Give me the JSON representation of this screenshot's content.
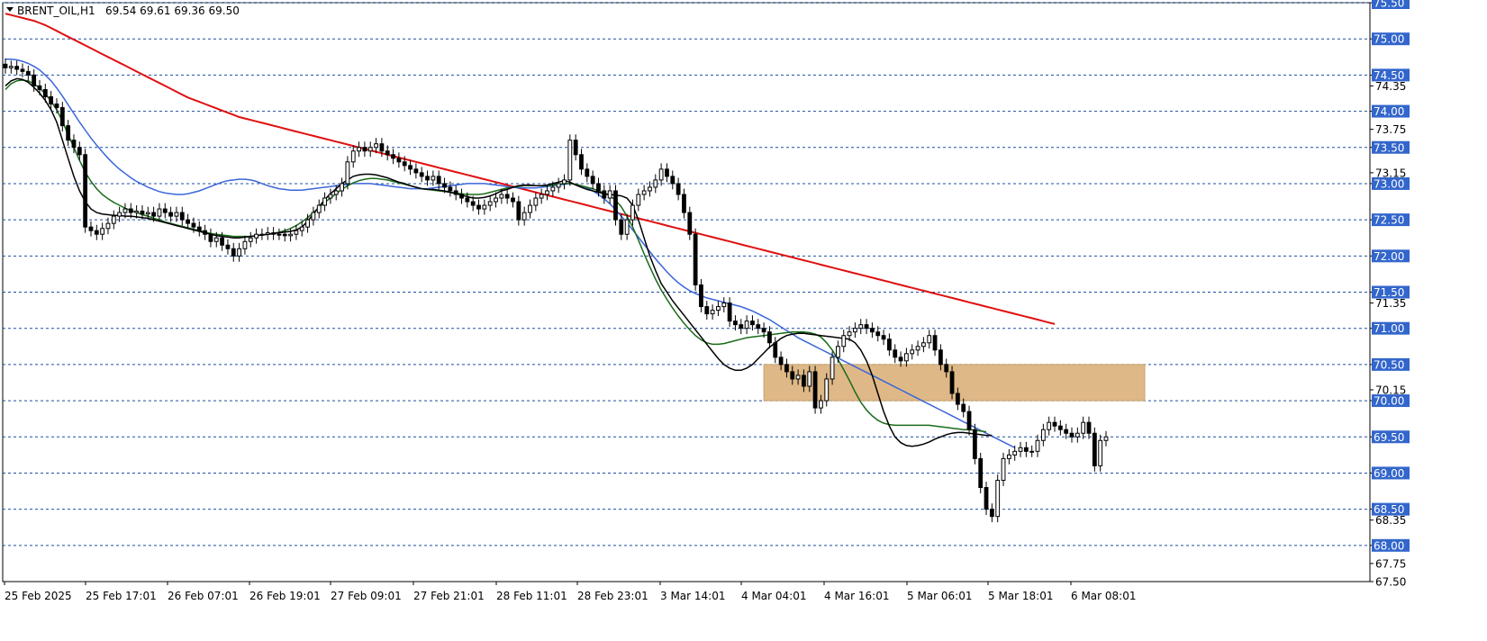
{
  "header": {
    "symbol_label": "BRENT_OIL,H1",
    "ohlc": "69.54 69.61 69.36 69.50"
  },
  "colors": {
    "bullish_candle": "#ffffff",
    "bearish_candle": "#000000",
    "ma_fast": "#000000",
    "ma_mid": "#1a6b1a",
    "ma_slow": "#3a66d9",
    "ma_long": "#e01010",
    "zone_fill": "#deb887",
    "level_line": "#1f4fa0",
    "level_tag_bg": "#3366cc"
  },
  "chart_data": {
    "type": "candlestick",
    "title": "BRENT_OIL,H1",
    "ylim": [
      67.5,
      75.5
    ],
    "y_ticks": [
      "75.50",
      "75.00",
      "74.50",
      "74.35",
      "74.00",
      "73.75",
      "73.50",
      "73.15",
      "73.00",
      "72.50",
      "72.00",
      "71.50",
      "71.35",
      "71.00",
      "70.50",
      "70.15",
      "70.00",
      "69.50",
      "69.00",
      "68.50",
      "68.35",
      "68.00",
      "67.75",
      "67.50"
    ],
    "level_lines": [
      75.5,
      75.0,
      74.5,
      74.0,
      73.5,
      73.0,
      72.5,
      72.0,
      71.5,
      71.0,
      70.5,
      70.0,
      69.5,
      69.0,
      68.5,
      68.0
    ],
    "level_tags": [
      "75.50",
      "75.00",
      "74.50",
      "74.00",
      "73.50",
      "73.00",
      "72.50",
      "72.00",
      "71.50",
      "71.00",
      "70.50",
      "70.00",
      "69.50",
      "69.00",
      "68.50",
      "68.00"
    ],
    "x_labels": [
      "25 Feb 2025",
      "25 Feb 17:01",
      "26 Feb 07:01",
      "26 Feb 19:01",
      "27 Feb 09:01",
      "27 Feb 21:01",
      "28 Feb 11:01",
      "28 Feb 23:01",
      "3 Mar 14:01",
      "4 Mar 04:01",
      "4 Mar 16:01",
      "5 Mar 06:01",
      "5 Mar 18:01",
      "6 Mar 08:01"
    ],
    "zone": {
      "top": 70.5,
      "bottom": 70.0,
      "start_bar": 133,
      "end_bar": 189
    },
    "closes": [
      74.6,
      74.62,
      74.58,
      74.55,
      74.5,
      74.35,
      74.3,
      74.2,
      74.1,
      74.05,
      73.8,
      73.6,
      73.5,
      73.4,
      72.4,
      72.35,
      72.3,
      72.38,
      72.45,
      72.55,
      72.6,
      72.65,
      72.6,
      72.62,
      72.58,
      72.6,
      72.55,
      72.65,
      72.6,
      72.55,
      72.6,
      72.5,
      72.45,
      72.4,
      72.35,
      72.3,
      72.2,
      72.25,
      72.15,
      72.1,
      72.0,
      72.1,
      72.2,
      72.25,
      72.3,
      72.3,
      72.32,
      72.3,
      72.3,
      72.28,
      72.3,
      72.35,
      72.4,
      72.5,
      72.6,
      72.7,
      72.8,
      72.85,
      72.9,
      73.0,
      73.3,
      73.45,
      73.5,
      73.45,
      73.5,
      73.55,
      73.45,
      73.4,
      73.35,
      73.3,
      73.25,
      73.2,
      73.15,
      73.1,
      73.05,
      73.1,
      73.0,
      72.95,
      72.9,
      72.85,
      72.8,
      72.75,
      72.7,
      72.65,
      72.7,
      72.75,
      72.8,
      72.85,
      72.8,
      72.75,
      72.5,
      72.6,
      72.7,
      72.8,
      72.85,
      72.9,
      72.95,
      73.0,
      73.05,
      73.6,
      73.4,
      73.2,
      73.1,
      73.0,
      72.9,
      72.8,
      72.9,
      72.5,
      72.3,
      72.5,
      72.7,
      72.85,
      72.9,
      72.95,
      73.05,
      73.2,
      73.1,
      73.0,
      72.85,
      72.6,
      72.3,
      71.6,
      71.3,
      71.2,
      71.25,
      71.3,
      71.35,
      71.1,
      71.05,
      71.0,
      71.1,
      71.05,
      71.0,
      70.95,
      70.8,
      70.6,
      70.5,
      70.4,
      70.3,
      70.35,
      70.2,
      70.4,
      69.9,
      70.0,
      70.3,
      70.6,
      70.75,
      70.9,
      70.95,
      71.0,
      71.05,
      71.0,
      70.95,
      70.9,
      70.85,
      70.7,
      70.6,
      70.55,
      70.65,
      70.7,
      70.75,
      70.8,
      70.9,
      70.7,
      70.5,
      70.4,
      70.1,
      69.95,
      69.85,
      69.6,
      69.2,
      68.8,
      68.5,
      68.4,
      68.9,
      69.2,
      69.25,
      69.3,
      69.35,
      69.3,
      69.3,
      69.45,
      69.6,
      69.7,
      69.65,
      69.6,
      69.55,
      69.5,
      69.55,
      69.7,
      69.55,
      69.1,
      69.45,
      69.5
    ],
    "ma_fast": [
      74.35,
      74.42,
      74.45,
      74.44,
      74.4,
      74.33,
      74.25,
      74.15,
      74.02,
      73.85,
      73.6,
      73.35,
      73.1,
      72.9,
      72.75,
      72.65,
      72.6,
      72.58,
      72.57,
      72.56,
      72.56,
      72.55,
      72.55,
      72.54,
      72.53,
      72.52,
      72.5,
      72.48,
      72.46,
      72.44,
      72.42,
      72.4,
      72.38,
      72.36,
      72.34,
      72.32,
      72.3,
      72.28,
      72.27,
      72.26,
      72.25,
      72.25,
      72.26,
      72.27,
      72.28,
      72.29,
      72.3,
      72.31,
      72.32,
      72.33,
      72.34,
      72.36,
      72.4,
      72.48,
      72.58,
      72.68,
      72.78,
      72.86,
      72.93,
      73.0,
      73.05,
      73.1,
      73.12,
      73.13,
      73.13,
      73.12,
      73.1,
      73.08,
      73.05,
      73.02,
      73.0,
      72.97,
      72.95,
      72.93,
      72.92,
      72.92,
      72.91,
      72.9,
      72.88,
      72.86,
      72.84,
      72.82,
      72.8,
      72.8,
      72.81,
      72.83,
      72.86,
      72.9,
      72.92,
      72.95,
      72.97,
      72.98,
      72.98,
      72.97,
      72.97,
      72.98,
      73.0,
      73.02,
      73.04,
      73.02,
      72.98,
      72.95,
      72.92,
      72.9,
      72.88,
      72.86,
      72.85,
      72.84,
      72.83,
      72.8,
      72.7,
      72.5,
      72.25,
      72.0,
      71.8,
      71.62,
      71.5,
      71.38,
      71.28,
      71.18,
      71.08,
      70.98,
      70.88,
      70.78,
      70.68,
      70.58,
      70.5,
      70.45,
      70.42,
      70.42,
      70.45,
      70.5,
      70.58,
      70.66,
      70.74,
      70.8,
      70.86,
      70.9,
      70.92,
      70.93,
      70.93,
      70.92,
      70.91,
      70.9,
      70.89,
      70.88,
      70.87,
      70.86,
      70.85,
      70.8,
      70.7,
      70.55,
      70.35,
      70.1,
      69.85,
      69.65,
      69.5,
      69.42,
      69.38,
      69.37,
      69.38,
      69.4,
      69.43,
      69.47,
      69.5,
      69.53,
      69.55,
      69.56,
      69.56,
      69.55,
      69.54,
      69.53,
      69.52,
      69.52
    ],
    "ma_mid": [
      74.3,
      74.38,
      74.42,
      74.43,
      74.42,
      74.38,
      74.32,
      74.24,
      74.14,
      74.02,
      73.86,
      73.68,
      73.5,
      73.32,
      73.16,
      73.03,
      72.93,
      72.85,
      72.79,
      72.74,
      72.7,
      72.66,
      72.63,
      72.6,
      72.57,
      72.55,
      72.52,
      72.5,
      72.47,
      72.45,
      72.43,
      72.41,
      72.39,
      72.37,
      72.35,
      72.33,
      72.31,
      72.3,
      72.29,
      72.28,
      72.27,
      72.27,
      72.27,
      72.27,
      72.28,
      72.29,
      72.3,
      72.31,
      72.33,
      72.35,
      72.38,
      72.42,
      72.47,
      72.53,
      72.6,
      72.67,
      72.74,
      72.8,
      72.86,
      72.92,
      72.97,
      73.01,
      73.04,
      73.06,
      73.07,
      73.07,
      73.06,
      73.05,
      73.03,
      73.01,
      72.99,
      72.97,
      72.95,
      72.93,
      72.92,
      72.91,
      72.9,
      72.89,
      72.88,
      72.87,
      72.86,
      72.85,
      72.85,
      72.85,
      72.86,
      72.88,
      72.9,
      72.92,
      72.94,
      72.95,
      72.96,
      72.97,
      72.97,
      72.97,
      72.97,
      72.97,
      72.98,
      72.99,
      73.0,
      73.0,
      72.99,
      72.97,
      72.95,
      72.93,
      72.9,
      72.87,
      72.83,
      72.77,
      72.68,
      72.55,
      72.4,
      72.22,
      72.03,
      71.85,
      71.68,
      71.53,
      71.4,
      71.28,
      71.17,
      71.07,
      70.98,
      70.9,
      70.84,
      70.8,
      70.78,
      70.78,
      70.79,
      70.81,
      70.83,
      70.85,
      70.87,
      70.88,
      70.89,
      70.9,
      70.91,
      70.92,
      70.93,
      70.94,
      70.95,
      70.95,
      70.95,
      70.94,
      70.92,
      70.88,
      70.8,
      70.7,
      70.57,
      70.43,
      70.28,
      70.12,
      69.98,
      69.87,
      69.79,
      69.73,
      69.69,
      69.67,
      69.66,
      69.66,
      69.66,
      69.66,
      69.66,
      69.66,
      69.66,
      69.65,
      69.64,
      69.63,
      69.62,
      69.61,
      69.6,
      69.6,
      69.59,
      69.58,
      69.57
    ],
    "ma_slow": [
      74.72,
      74.72,
      74.71,
      74.69,
      74.66,
      74.62,
      74.57,
      74.5,
      74.42,
      74.32,
      74.21,
      74.09,
      73.97,
      73.85,
      73.74,
      73.63,
      73.53,
      73.44,
      73.35,
      73.27,
      73.2,
      73.14,
      73.08,
      73.03,
      72.99,
      72.95,
      72.92,
      72.89,
      72.87,
      72.86,
      72.85,
      72.85,
      72.86,
      72.88,
      72.9,
      72.93,
      72.96,
      72.99,
      73.02,
      73.04,
      73.05,
      73.06,
      73.06,
      73.05,
      73.03,
      73.0,
      72.97,
      72.95,
      72.93,
      72.92,
      72.91,
      72.91,
      72.91,
      72.92,
      72.93,
      72.94,
      72.95,
      72.96,
      72.97,
      72.98,
      72.99,
      73.0,
      73.0,
      73.0,
      73.0,
      72.99,
      72.98,
      72.97,
      72.96,
      72.95,
      72.94,
      72.93,
      72.93,
      72.93,
      72.93,
      72.94,
      72.95,
      72.96,
      72.97,
      72.98,
      72.99,
      73.0,
      73.0,
      73.0,
      73.0,
      72.99,
      72.98,
      72.97,
      72.96,
      72.95,
      72.94,
      72.94,
      72.94,
      72.94,
      72.95,
      72.96,
      72.97,
      72.98,
      72.99,
      73.0,
      72.99,
      72.97,
      72.94,
      72.9,
      72.85,
      72.79,
      72.72,
      72.64,
      72.55,
      72.46,
      72.36,
      72.26,
      72.16,
      72.06,
      71.96,
      71.87,
      71.78,
      71.7,
      71.63,
      71.57,
      71.52,
      71.48,
      71.45,
      71.42,
      71.4,
      71.38,
      71.36,
      71.34,
      71.32,
      71.3,
      71.27,
      71.24,
      71.2,
      71.16,
      71.12,
      71.07,
      71.02,
      70.97,
      70.92,
      70.87,
      70.83,
      70.79,
      70.75,
      70.71,
      70.67,
      70.63,
      70.59,
      70.55,
      70.51,
      70.47,
      70.43,
      70.39,
      70.35,
      70.31,
      70.27,
      70.23,
      70.19,
      70.15,
      70.11,
      70.07,
      70.03,
      69.99,
      69.95,
      69.91,
      69.87,
      69.83,
      69.79,
      69.75,
      69.71,
      69.67,
      69.63,
      69.59,
      69.55,
      69.51,
      69.47,
      69.43,
      69.39,
      69.35
    ],
    "ma_long": [
      75.35,
      75.33,
      75.31,
      75.29,
      75.27,
      75.25,
      75.22,
      75.19,
      75.15,
      75.11,
      75.07,
      75.03,
      74.99,
      74.95,
      74.91,
      74.87,
      74.83,
      74.79,
      74.75,
      74.71,
      74.67,
      74.63,
      74.59,
      74.55,
      74.51,
      74.47,
      74.43,
      74.39,
      74.35,
      74.31,
      74.27,
      74.23,
      74.19,
      74.16,
      74.13,
      74.1,
      74.07,
      74.04,
      74.01,
      73.98,
      73.95,
      73.92,
      73.9,
      73.88,
      73.86,
      73.84,
      73.82,
      73.8,
      73.78,
      73.76,
      73.74,
      73.72,
      73.7,
      73.68,
      73.66,
      73.64,
      73.62,
      73.6,
      73.58,
      73.56,
      73.54,
      73.52,
      73.5,
      73.48,
      73.46,
      73.44,
      73.42,
      73.4,
      73.38,
      73.36,
      73.34,
      73.32,
      73.3,
      73.28,
      73.26,
      73.24,
      73.22,
      73.2,
      73.18,
      73.16,
      73.14,
      73.12,
      73.1,
      73.08,
      73.06,
      73.04,
      73.02,
      73.0,
      72.98,
      72.96,
      72.94,
      72.92,
      72.9,
      72.88,
      72.86,
      72.84,
      72.82,
      72.8,
      72.78,
      72.76,
      72.74,
      72.72,
      72.7,
      72.68,
      72.66,
      72.64,
      72.62,
      72.6,
      72.58,
      72.56,
      72.54,
      72.52,
      72.5,
      72.48,
      72.46,
      72.44,
      72.42,
      72.4,
      72.38,
      72.36,
      72.34,
      72.32,
      72.3,
      72.28,
      72.26,
      72.24,
      72.22,
      72.2,
      72.18,
      72.16,
      72.14,
      72.12,
      72.1,
      72.08,
      72.06,
      72.04,
      72.02,
      72.0,
      71.98,
      71.96,
      71.94,
      71.92,
      71.9,
      71.88,
      71.86,
      71.84,
      71.82,
      71.8,
      71.78,
      71.76,
      71.74,
      71.72,
      71.7,
      71.68,
      71.66,
      71.64,
      71.62,
      71.6,
      71.58,
      71.56,
      71.54,
      71.52,
      71.5,
      71.48,
      71.46,
      71.44,
      71.42,
      71.4,
      71.38,
      71.36,
      71.34,
      71.32,
      71.3,
      71.28,
      71.26,
      71.24,
      71.22,
      71.2,
      71.18,
      71.16,
      71.14,
      71.12,
      71.1,
      71.08,
      71.06
    ]
  }
}
